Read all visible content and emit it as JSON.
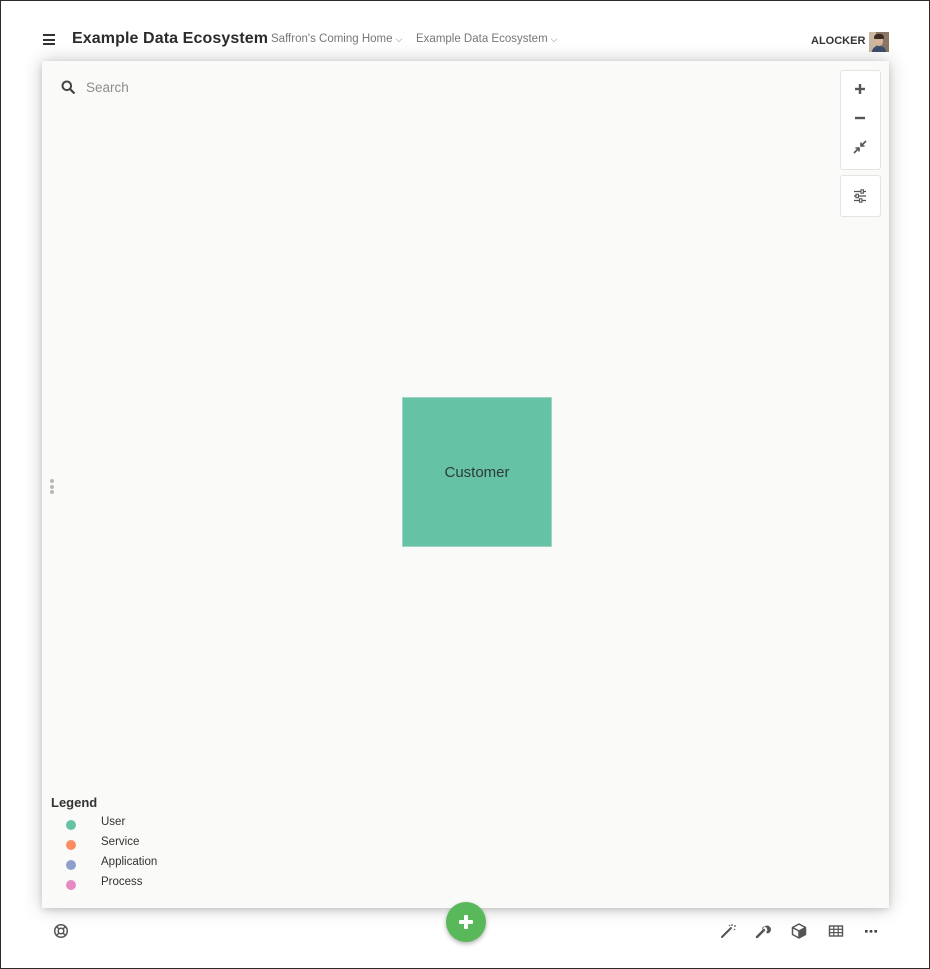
{
  "header": {
    "title": "Example Data Ecosystem",
    "breadcrumbs": [
      {
        "label": "Saffron's Coming Home"
      },
      {
        "label": "Example Data Ecosystem"
      }
    ],
    "username": "ALOCKER"
  },
  "search": {
    "placeholder": "Search",
    "value": ""
  },
  "canvas": {
    "nodes": [
      {
        "label": "Customer",
        "type": "User",
        "color": "#66c2a5"
      }
    ]
  },
  "legend": {
    "title": "Legend",
    "items": [
      {
        "label": "User",
        "color": "#66c2a5"
      },
      {
        "label": "Service",
        "color": "#fc8d62"
      },
      {
        "label": "Application",
        "color": "#8da0cb"
      },
      {
        "label": "Process",
        "color": "#e78ac3"
      }
    ]
  },
  "icons": {
    "zoom_controls": [
      "plus-icon",
      "minus-icon",
      "collapse-arrows-icon"
    ],
    "settings": "sliders-icon",
    "footer_left": "life-ring-icon",
    "footer_center": "plus-icon",
    "footer_right": [
      "magic-wand-icon",
      "wrench-icon",
      "cube-icon",
      "table-icon",
      "ellipsis-icon"
    ]
  },
  "colors": {
    "accent_green": "#58b85a"
  }
}
